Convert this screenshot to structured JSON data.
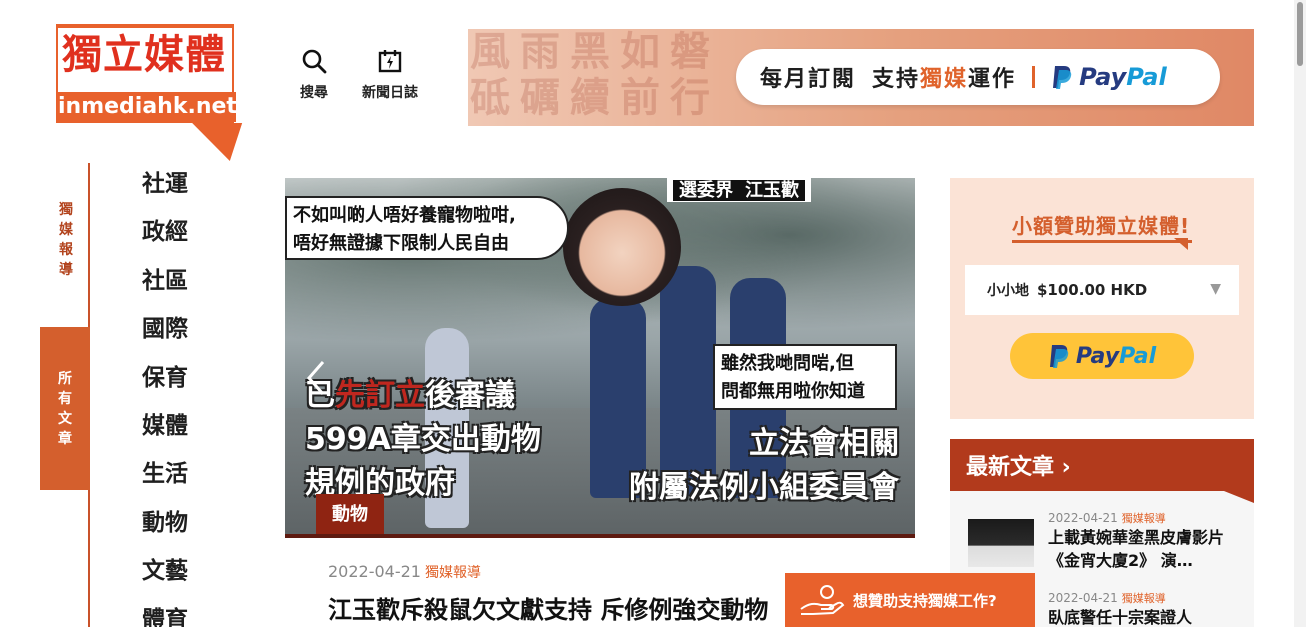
{
  "logo": {
    "cn": "獨立媒體",
    "en": "inmediahk.net"
  },
  "top_nav": {
    "search": "搜尋",
    "journal": "新聞日誌"
  },
  "banner": {
    "bg_text_line1": "風雨黑如磐",
    "bg_text_line2": "砥礪續前行",
    "pill_part1": "每月訂閱",
    "pill_part2_a": "支持",
    "pill_part2_hl": "獨媒",
    "pill_part2_b": "運作",
    "paypal_a": "Pay",
    "paypal_b": "Pal"
  },
  "side_tabs": {
    "reports": "獨媒報導",
    "all": "所有文章"
  },
  "categories": [
    "社運",
    "政經",
    "社區",
    "國際",
    "保育",
    "媒體",
    "生活",
    "動物",
    "文藝",
    "體育"
  ],
  "hero": {
    "caption_label": "選委界",
    "caption_name": "江玉歡",
    "bubble1_l1": "不如叫啲人唔好養寵物啦咁,",
    "bubble1_l2": "唔好無證據下限制人民自由",
    "bubble2_l1": "雖然我哋問啱,但",
    "bubble2_l2": "問都無用啦你知道",
    "left_l1_a": "已",
    "left_l1_red": "先訂立",
    "left_l1_b": "後審議",
    "left_l2": "599A章交出動物",
    "left_l3": "規例的政府",
    "right_l1": "立法會相關",
    "right_l2": "附屬法例小組委員會",
    "tag": "動物"
  },
  "article": {
    "date": "2022-04-21",
    "source": "獨媒報導",
    "headline": "江玉歡斥殺鼠欠文獻支持 斥修例強交動物"
  },
  "donate": {
    "title": "小額贊助獨立媒體!",
    "select_label": "小小地",
    "select_value": "$100.00 HKD",
    "paypal_a": "Pay",
    "paypal_b": "Pal"
  },
  "latest": {
    "heading": "最新文章 ›",
    "items": [
      {
        "date": "2022-04-21",
        "source": "獨媒報導",
        "title": "上載黃婉華塗黑皮膚影片《金宵大廈2》 演…"
      },
      {
        "date": "2022-04-21",
        "source": "獨媒報導",
        "title": "臥底警任十宗案證人"
      }
    ]
  },
  "cta": {
    "label": "想贊助支持獨媒工作?"
  },
  "colors": {
    "accent": "#e8612c",
    "dark_red": "#b23a1c",
    "paypal_yellow": "#ffc439",
    "paypal_blue": "#253b80",
    "paypal_light_blue": "#179bd7"
  },
  "icons": {
    "search": "search-icon",
    "journal": "journal-icon",
    "arrow_left": "chevron-left-icon",
    "arrow_right": "chevron-right-icon",
    "hand": "hand-coin-icon"
  }
}
